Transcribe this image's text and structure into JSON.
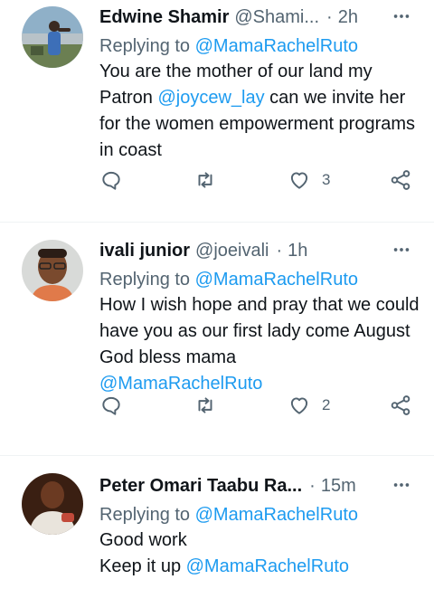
{
  "colors": {
    "link": "#1d9bf0",
    "secondary": "#536471",
    "text": "#0f1419",
    "divider": "#eff3f4"
  },
  "tweets": [
    {
      "name": "Edwine Shamir",
      "handle": "@Shami...",
      "time": "2h",
      "replying_label": "Replying to",
      "replying_to": "@MamaRachelRuto",
      "body_before": "You are the mother of our land my Patron ",
      "body_mention": "@joycew_lay",
      "body_after": " can we invite her for the women empowerment programs in coast",
      "likes": "3",
      "icons": [
        "reply-icon",
        "retweet-icon",
        "like-icon",
        "share-icon",
        "more-icon"
      ]
    },
    {
      "name": "ivali junior",
      "handle": "@joeivali",
      "time": "1h",
      "replying_label": "Replying to",
      "replying_to": "@MamaRachelRuto",
      "body_before": "How I wish hope and pray that we could have you as our first lady come August God bless mama",
      "body_mention": "@MamaRachelRuto",
      "body_after": "",
      "likes": "2",
      "icons": [
        "reply-icon",
        "retweet-icon",
        "like-icon",
        "share-icon",
        "more-icon"
      ]
    },
    {
      "name": "Peter Omari Taabu Ra...",
      "handle": "",
      "time": "15m",
      "replying_label": "Replying to",
      "replying_to": "@MamaRachelRuto",
      "body_line1": "Good work",
      "body_line2_before": "Keep it up ",
      "body_mention": "@MamaRachelRuto",
      "icons": [
        "more-icon"
      ]
    }
  ]
}
